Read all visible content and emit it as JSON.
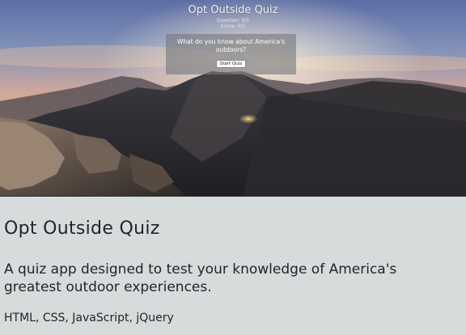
{
  "hero": {
    "app_title": "Opt Outside Quiz",
    "question_counter": "Question: 0/5",
    "score": "Score: 0/5",
    "prompt": "What do you know about America's outdoors?",
    "start_button": "Start Quiz",
    "image": "mountain-landscape-sunset"
  },
  "project": {
    "title": "Opt Outside Quiz",
    "description": "A quiz app designed to test your knowledge of America's greatest outdoor experiences.",
    "technologies": "HTML, CSS, JavaScript, jQuery"
  },
  "colors": {
    "page_background": "#d6dcdb",
    "text": "#202628"
  }
}
